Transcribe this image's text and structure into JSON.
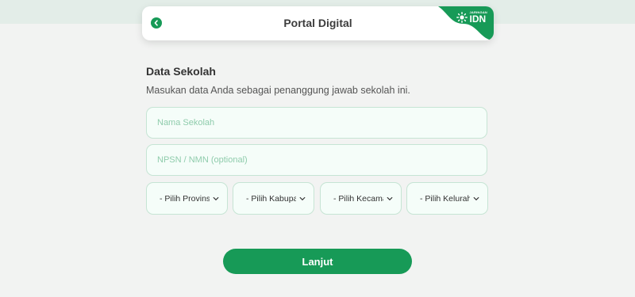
{
  "header": {
    "title": "Portal Digital",
    "brand": {
      "small": "JARINGAN",
      "name": "IDN"
    },
    "back_icon": "chevron-left-icon",
    "accent": "#179a57"
  },
  "form": {
    "title": "Data Sekolah",
    "description": "Masukan data Anda sebagai penanggung jawab sekolah ini.",
    "school_name": {
      "placeholder": "Nama Sekolah",
      "value": ""
    },
    "npsn": {
      "placeholder": "NPSN / NMN (optional)",
      "value": ""
    },
    "selects": [
      {
        "label": "- Pilih Provinsi"
      },
      {
        "label": "- Pilih Kabupaten"
      },
      {
        "label": "- Pilih Kecamatan"
      },
      {
        "label": "- Pilih Kelurahan"
      }
    ],
    "submit_label": "Lanjut"
  }
}
